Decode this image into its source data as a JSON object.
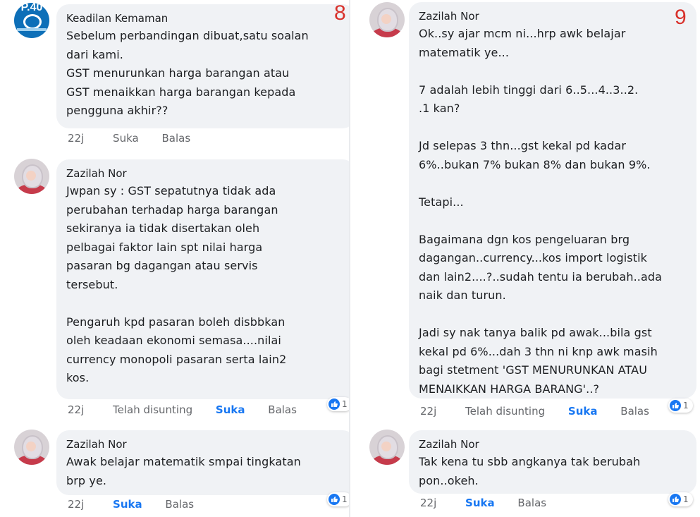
{
  "comments": [
    {
      "author": "Keadilan Kemaman",
      "number": "8",
      "avatar_text": "P.40",
      "text": "Sebelum perbandingan dibuat,satu soalan\ndari kami.\nGST menurunkan harga barangan atau\nGST menaikkan harga barangan kepada\npengguna akhir??",
      "time": "22j",
      "like": "Suka",
      "reply": "Balas"
    },
    {
      "author": "Zazilah Nor",
      "text": "Jwpan sy : GST sepatutnya tidak ada\nperubahan terhadap harga barangan\nsekiranya ia tidak disertakan oleh\npelbagai faktor lain spt nilai harga\npasaran bg dagangan atau servis\ntersebut.\n\nPengaruh kpd pasaran boleh disbbkan\noleh keadaan ekonomi semasa....nilai\ncurrency monopoli pasaran serta lain2\nkos.",
      "time": "22j",
      "edited": "Telah disunting",
      "like": "Suka",
      "reply": "Balas",
      "reactions": "1"
    },
    {
      "author": "Zazilah Nor",
      "text": "Awak belajar matematik smpai tingkatan\nbrp ye.",
      "time": "22j",
      "like": "Suka",
      "reply": "Balas",
      "reactions": "1"
    },
    {
      "author": "Zazilah Nor",
      "number": "9",
      "text": "Ok..sy ajar mcm ni...hrp awk belajar\nmatematik ye...\n\n7 adalah lebih tinggi dari 6..5...4..3..2.\n.1 kan?\n\nJd selepas 3 thn...gst kekal pd kadar\n6%..bukan 7% bukan 8% dan bukan 9%.\n\nTetapi...\n\nBagaimana dgn kos pengeluaran brg\ndagangan..currency...kos import logistik\ndan lain2....?..sudah tentu ia berubah..ada\nnaik dan turun.\n\nJadi sy nak tanya balik pd awak...bila gst\nkekal pd 6%...dah 3 thn ni knp awk masih\nbagi stetment 'GST MENURUNKAN ATAU\nMENAIKKAN HARGA BARANG'..?",
      "time": "22j",
      "edited": "Telah disunting",
      "like": "Suka",
      "reply": "Balas",
      "reactions": "1"
    },
    {
      "author": "Zazilah Nor",
      "text": "Tak kena tu sbb angkanya tak berubah\npon..okeh.",
      "time": "22j",
      "like": "Suka",
      "reply": "Balas",
      "reactions": "1"
    }
  ]
}
